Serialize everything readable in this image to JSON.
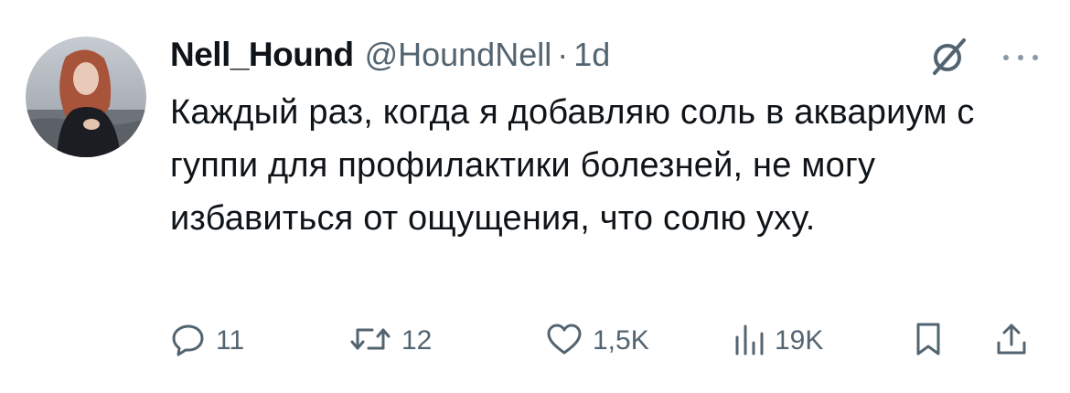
{
  "tweet": {
    "display_name": "Nell_Hound",
    "handle": "@HoundNell",
    "separator": "·",
    "time": "1d",
    "text": "Каждый раз, когда я добавляю соль в аквариум с гуппи для профилактики болезней, не могу избавиться от ощущения, что солю уху."
  },
  "actions": {
    "reply_count": "11",
    "retweet_count": "12",
    "like_count": "1,5K",
    "views_count": "19K"
  },
  "icons": {
    "grok": "grok-icon",
    "more": "more-dots-icon",
    "reply": "reply-icon",
    "retweet": "retweet-icon",
    "like": "heart-icon",
    "views": "views-chart-icon",
    "bookmark": "bookmark-icon",
    "share": "share-icon"
  },
  "colors": {
    "text_primary": "#0f1419",
    "text_secondary": "#536471",
    "background": "#ffffff"
  }
}
